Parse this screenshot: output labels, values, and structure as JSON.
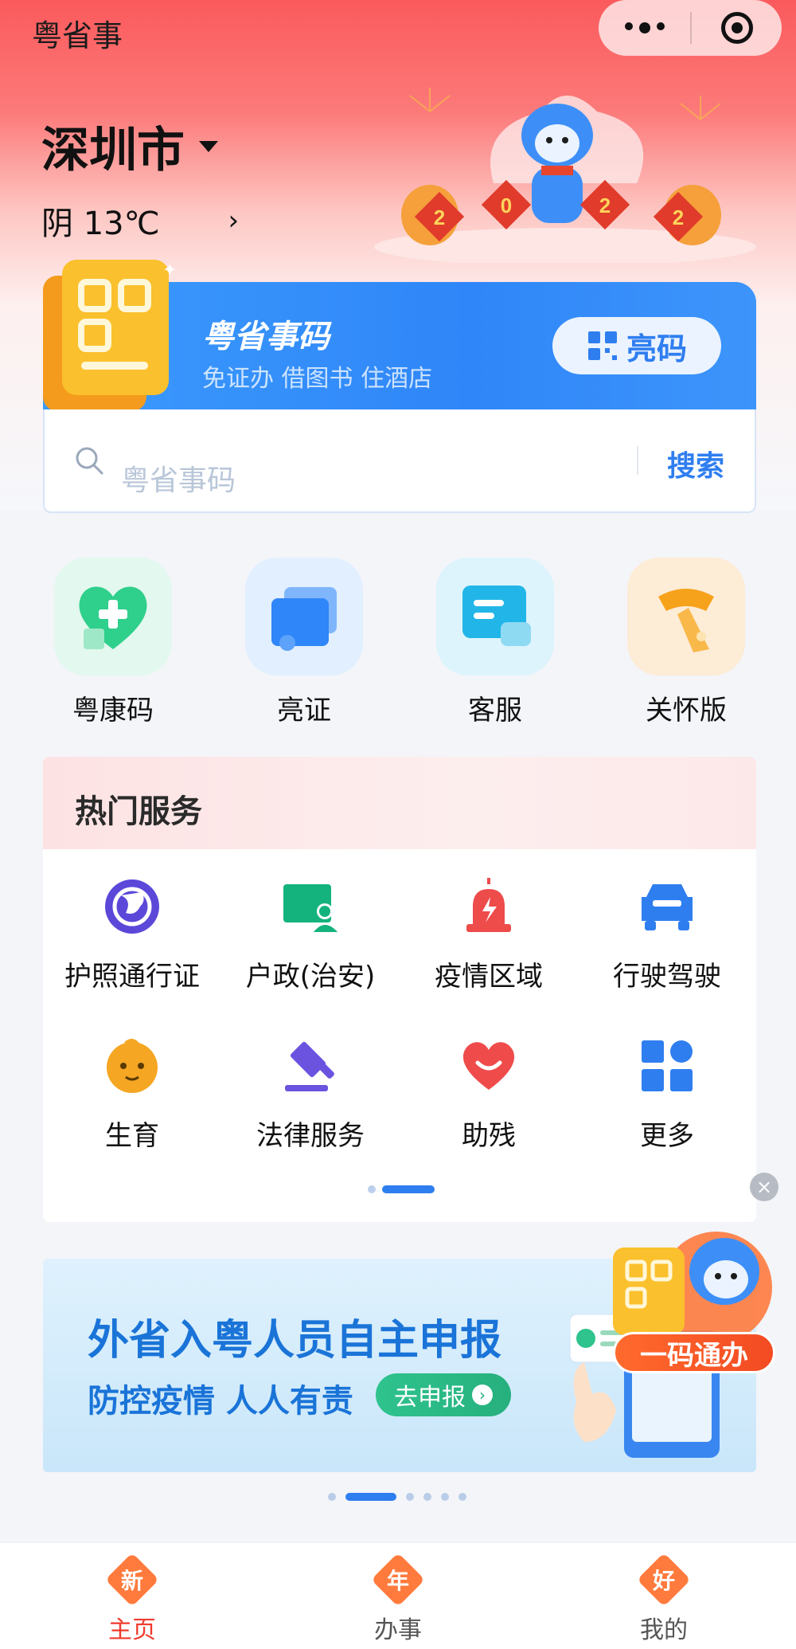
{
  "app": {
    "title": "粤省事"
  },
  "location": {
    "city": "深圳市",
    "weather": "阴 13℃"
  },
  "code_card": {
    "title": "粤省事码",
    "subtitle": "免证办 借图书 住酒店",
    "button_label": "亮码"
  },
  "search": {
    "placeholder": "粤省事码",
    "button_label": "搜索"
  },
  "quick_actions": [
    {
      "label": "粤康码",
      "icon": "heart-qr-icon",
      "color": "#2fcf8c"
    },
    {
      "label": "亮证",
      "icon": "cards-icon",
      "color": "#2f86f8"
    },
    {
      "label": "客服",
      "icon": "chat-icon",
      "color": "#22b6e8"
    },
    {
      "label": "关怀版",
      "icon": "scarf-icon",
      "color": "#f7a21b"
    }
  ],
  "hot_services": {
    "title": "热门服务",
    "items": [
      {
        "label": "护照通行证",
        "icon": "globe-icon",
        "color": "#5b48d9"
      },
      {
        "label": "户政(治安)",
        "icon": "id-card-icon",
        "color": "#14b37d"
      },
      {
        "label": "疫情区域",
        "icon": "alarm-icon",
        "color": "#ee4b4b"
      },
      {
        "label": "行驶驾驶",
        "icon": "car-icon",
        "color": "#2f7ef0"
      },
      {
        "label": "生育",
        "icon": "baby-icon",
        "color": "#f5a623"
      },
      {
        "label": "法律服务",
        "icon": "gavel-icon",
        "color": "#6b53e0"
      },
      {
        "label": "助残",
        "icon": "heart-icon",
        "color": "#ef4b4b"
      },
      {
        "label": "更多",
        "icon": "grid-more-icon",
        "color": "#2f7ef0"
      }
    ]
  },
  "banner": {
    "title": "外省入粤人员自主申报",
    "subtitle": "防控疫情 人人有责",
    "button_label": "去申报"
  },
  "float_badge": {
    "label": "一码通办"
  },
  "festive_number": [
    "2",
    "0",
    "2",
    "2"
  ],
  "tabbar": [
    {
      "label": "主页",
      "glyph": "新",
      "active": true
    },
    {
      "label": "办事",
      "glyph": "年",
      "active": false
    },
    {
      "label": "我的",
      "glyph": "好",
      "active": false
    }
  ],
  "colors": {
    "accent": "#2f7ef0",
    "header_red": "#fb5a5c",
    "tab_active": "#ef3b2d"
  }
}
